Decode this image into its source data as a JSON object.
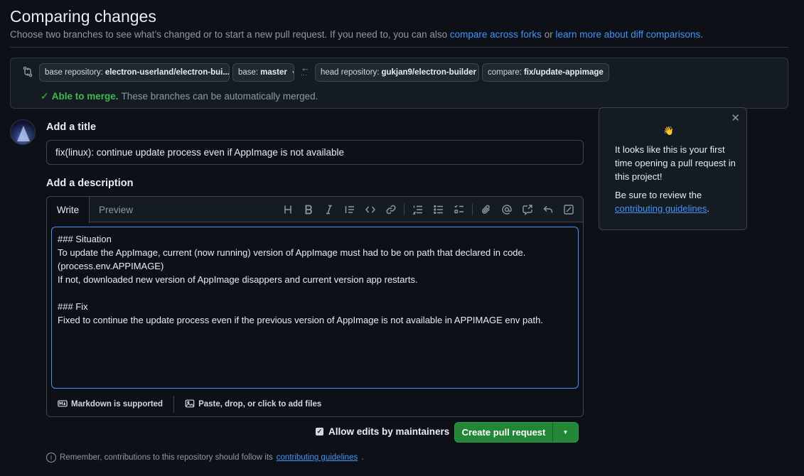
{
  "header": {
    "title": "Comparing changes",
    "subtitle_prefix": "Choose two branches to see what’s changed or to start a new pull request. If you need to, you can also ",
    "link_forks": "compare across forks",
    "subtitle_mid": " or ",
    "link_learn": "learn more about diff comparisons",
    "subtitle_end": "."
  },
  "range": {
    "base_repo_label": "base repository:",
    "base_repo_value": "electron-userland/electron-bui...",
    "base_label": "base:",
    "base_value": "master",
    "head_repo_label": "head repository:",
    "head_repo_value": "gukjan9/electron-builder",
    "compare_label": "compare:",
    "compare_value": "fix/update-appimage",
    "merge_status": "Able to merge.",
    "merge_detail": "These branches can be automatically merged."
  },
  "form": {
    "title_label": "Add a title",
    "title_value": "fix(linux): continue update process even if AppImage is not available",
    "description_label": "Add a description",
    "tab_write": "Write",
    "tab_preview": "Preview",
    "body": "### Situation\nTo update the AppImage, current (now running) version of AppImage must had to be on path that declared in code.\n(process.env.APPIMAGE)\nIf not, downloaded new version of AppImage disappers and current version app restarts.\n\n### Fix\nFixed to continue the update process even if the previous version of AppImage is not available in APPIMAGE env path.",
    "markdown_note": "Markdown is supported",
    "attach_note": "Paste, drop, or click to add files",
    "allow_edits": "Allow edits by maintainers",
    "create_button": "Create pull request",
    "remember_prefix": "Remember, contributions to this repository should follow its ",
    "remember_link": "contributing guidelines",
    "remember_end": "."
  },
  "popover": {
    "wave": "👋",
    "line1": "It looks like this is your first time opening a pull request in this project!",
    "line2_prefix": "Be sure to review the ",
    "line2_link": "contributing guidelines",
    "line2_end": "."
  },
  "icons": {
    "toolbar": [
      "heading-icon",
      "bold-icon",
      "italic-icon",
      "quote-icon",
      "code-icon",
      "link-icon",
      "numbered-list-icon",
      "unordered-list-icon",
      "task-list-icon",
      "attach-icon",
      "mention-icon",
      "cross-reference-icon",
      "reply-icon",
      "fullscreen-icon"
    ]
  },
  "colors": {
    "accent": "#4493f8",
    "success": "#3fb950",
    "button_green": "#238636",
    "background": "#0d1117"
  }
}
